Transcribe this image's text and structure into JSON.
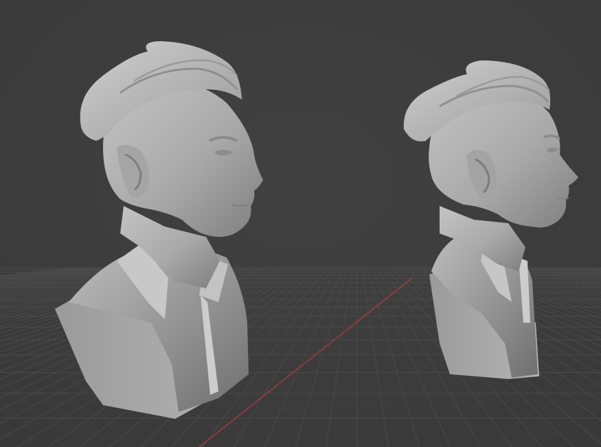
{
  "viewport": {
    "background": "#3d3d3d",
    "grid_color": "#4a4a4a",
    "x_axis_color": "#a43a44",
    "mesh_color": "#a9a9a9"
  },
  "objects": [
    {
      "name": "bust-near",
      "kind": "sculpted-bust-mesh"
    },
    {
      "name": "bust-far",
      "kind": "sculpted-bust-mesh"
    }
  ]
}
